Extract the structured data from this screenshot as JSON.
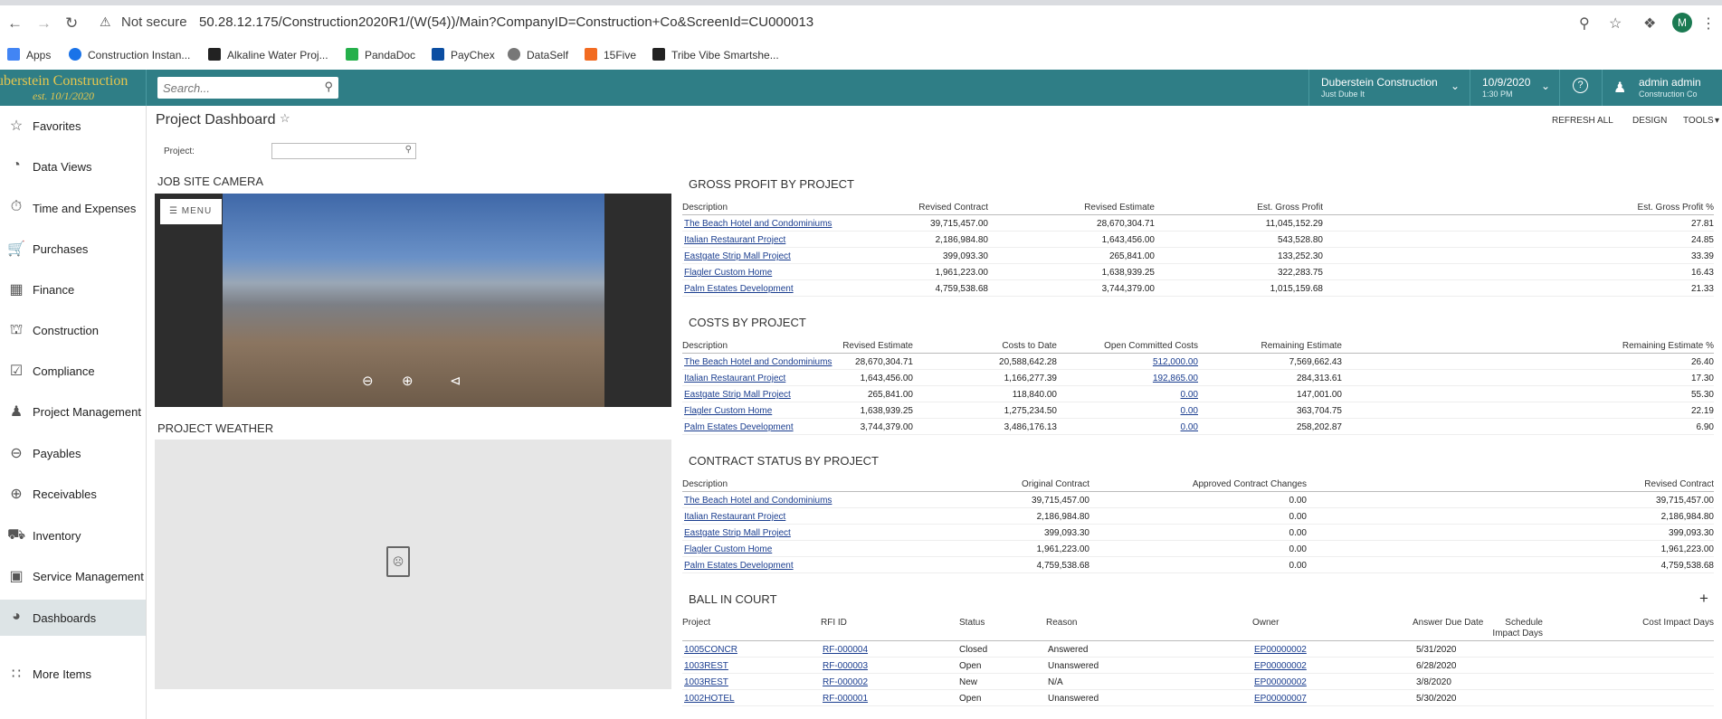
{
  "browser": {
    "not_secure": "Not secure",
    "url": "50.28.12.175/Construction2020R1/(W(54))/Main?CompanyID=Construction+Co&ScreenId=CU000013",
    "profile_initial": "M",
    "bookmarks": [
      "Apps",
      "Construction Instan...",
      "Alkaline Water Proj...",
      "PandaDoc",
      "PayChex",
      "DataSelf",
      "15Five",
      "Tribe Vibe Smartshe..."
    ]
  },
  "header": {
    "logo_line1": "uberstein Construction",
    "logo_line2": "est. 10/1/2020",
    "search_placeholder": "Search...",
    "company": "Duberstein Construction",
    "company_sub": "Just Dube It",
    "date": "10/9/2020",
    "time": "1:30 PM",
    "user": "admin admin",
    "user_sub": "Construction Co",
    "brand_color": "#2f7e86"
  },
  "sidebar": {
    "items": [
      {
        "label": "Favorites",
        "icon": "star-icon"
      },
      {
        "label": "Data Views",
        "icon": "pie-chart-icon"
      },
      {
        "label": "Time and Expenses",
        "icon": "stopwatch-icon"
      },
      {
        "label": "Purchases",
        "icon": "cart-icon"
      },
      {
        "label": "Finance",
        "icon": "calculator-icon"
      },
      {
        "label": "Construction",
        "icon": "crane-icon"
      },
      {
        "label": "Compliance",
        "icon": "checklist-icon"
      },
      {
        "label": "Project Management",
        "icon": "person-icon"
      },
      {
        "label": "Payables",
        "icon": "minus-circle-icon"
      },
      {
        "label": "Receivables",
        "icon": "plus-circle-icon"
      },
      {
        "label": "Inventory",
        "icon": "truck-icon"
      },
      {
        "label": "Service Management",
        "icon": "briefcase-icon"
      },
      {
        "label": "Dashboards",
        "icon": "gauge-icon"
      }
    ],
    "more": "More Items"
  },
  "page": {
    "title": "Project Dashboard",
    "actions": [
      "REFRESH ALL",
      "DESIGN",
      "TOOLS"
    ],
    "project_label": "Project:",
    "camera_title": "JOB SITE CAMERA",
    "menu_label": "MENU",
    "weather_title": "PROJECT WEATHER"
  },
  "gross_profit": {
    "title": "GROSS PROFIT BY PROJECT",
    "headers": [
      "Description",
      "Revised Contract",
      "Revised Estimate",
      "Est. Gross Profit",
      "Est. Gross Profit %"
    ],
    "rows": [
      [
        "The Beach Hotel and Condominiums",
        "39,715,457.00",
        "28,670,304.71",
        "11,045,152.29",
        "27.81"
      ],
      [
        "Italian Restaurant Project",
        "2,186,984.80",
        "1,643,456.00",
        "543,528.80",
        "24.85"
      ],
      [
        "Eastgate Strip Mall Project",
        "399,093.30",
        "265,841.00",
        "133,252.30",
        "33.39"
      ],
      [
        "Flagler Custom Home",
        "1,961,223.00",
        "1,638,939.25",
        "322,283.75",
        "16.43"
      ],
      [
        "Palm Estates Development",
        "4,759,538.68",
        "3,744,379.00",
        "1,015,159.68",
        "21.33"
      ]
    ]
  },
  "costs": {
    "title": "COSTS BY PROJECT",
    "headers": [
      "Description",
      "Revised Estimate",
      "Costs to Date",
      "Open Committed Costs",
      "Remaining Estimate",
      "Remaining Estimate %"
    ],
    "rows": [
      [
        "The Beach Hotel and Condominiums",
        "28,670,304.71",
        "20,588,642.28",
        "512,000.00",
        "7,569,662.43",
        "26.40"
      ],
      [
        "Italian Restaurant Project",
        "1,643,456.00",
        "1,166,277.39",
        "192,865.00",
        "284,313.61",
        "17.30"
      ],
      [
        "Eastgate Strip Mall Project",
        "265,841.00",
        "118,840.00",
        "0.00",
        "147,001.00",
        "55.30"
      ],
      [
        "Flagler Custom Home",
        "1,638,939.25",
        "1,275,234.50",
        "0.00",
        "363,704.75",
        "22.19"
      ],
      [
        "Palm Estates Development",
        "3,744,379.00",
        "3,486,176.13",
        "0.00",
        "258,202.87",
        "6.90"
      ]
    ]
  },
  "contract": {
    "title": "CONTRACT STATUS BY PROJECT",
    "headers": [
      "Description",
      "Original Contract",
      "Approved Contract Changes",
      "Revised Contract"
    ],
    "rows": [
      [
        "The Beach Hotel and Condominiums",
        "39,715,457.00",
        "0.00",
        "39,715,457.00"
      ],
      [
        "Italian Restaurant Project",
        "2,186,984.80",
        "0.00",
        "2,186,984.80"
      ],
      [
        "Eastgate Strip Mall Project",
        "399,093.30",
        "0.00",
        "399,093.30"
      ],
      [
        "Flagler Custom Home",
        "1,961,223.00",
        "0.00",
        "1,961,223.00"
      ],
      [
        "Palm Estates Development",
        "4,759,538.68",
        "0.00",
        "4,759,538.68"
      ]
    ]
  },
  "ball": {
    "title": "BALL IN COURT",
    "headers": [
      "Project",
      "RFI ID",
      "Status",
      "Reason",
      "Owner",
      "Answer Due Date",
      "Schedule",
      "Impact Days",
      "Cost Impact Days"
    ],
    "rows": [
      [
        "1005CONCR",
        "RF-000004",
        "Closed",
        "Answered",
        "EP00000002",
        "5/31/2020"
      ],
      [
        "1003REST",
        "RF-000003",
        "Open",
        "Unanswered",
        "EP00000002",
        "6/28/2020"
      ],
      [
        "1003REST",
        "RF-000002",
        "New",
        "N/A",
        "EP00000002",
        "3/8/2020"
      ],
      [
        "1002HOTEL",
        "RF-000001",
        "Open",
        "Unanswered",
        "EP00000007",
        "5/30/2020"
      ]
    ]
  }
}
